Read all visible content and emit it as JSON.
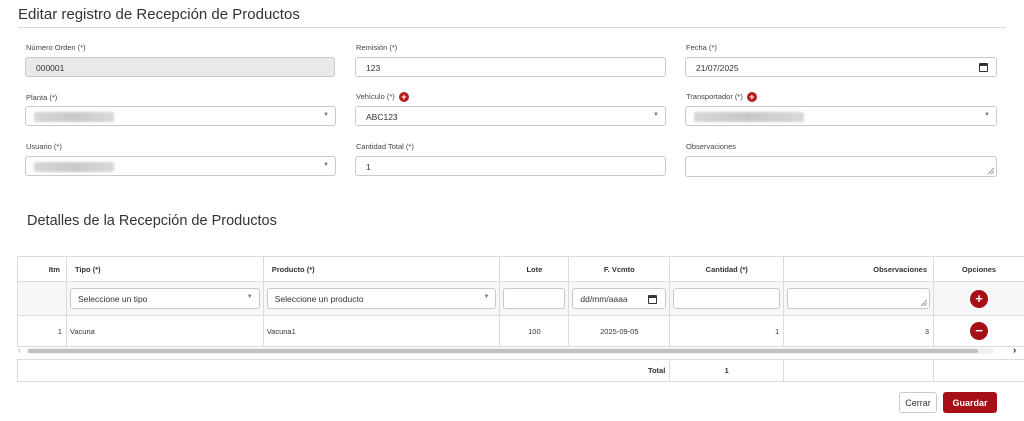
{
  "header": {
    "title": "Editar registro de Recepción de Productos"
  },
  "form": {
    "numero_orden": {
      "label": "Número Orden (*)",
      "value": "000001"
    },
    "remision": {
      "label": "Remisión (*)",
      "value": "123"
    },
    "fecha": {
      "label": "Fecha (*)",
      "value": "21/07/2025"
    },
    "planta": {
      "label": "Planta (*)",
      "value": ""
    },
    "vehiculo": {
      "label": "Vehículo (*)",
      "value": "ABC123"
    },
    "transportador": {
      "label": "Transportador (*)",
      "value": ""
    },
    "usuario": {
      "label": "Usuario (*)",
      "value": ""
    },
    "cantidad_total": {
      "label": "Cantidad Total (*)",
      "value": "1"
    },
    "observaciones": {
      "label": "Observaciones",
      "value": ""
    }
  },
  "details": {
    "title": "Detalles de la Recepción de Productos",
    "columns": {
      "itm": "Itm",
      "tipo": "Tipo (*)",
      "producto": "Producto (*)",
      "lote": "Lote",
      "vcmto": "F. Vcmto",
      "cantidad": "Cantidad (*)",
      "observaciones": "Observaciones",
      "opciones": "Opciones"
    },
    "new_row": {
      "tipo_placeholder": "Seleccione un tipo",
      "producto_placeholder": "Seleccione un producto",
      "fecha_placeholder": "dd/mm/aaaa"
    },
    "rows": [
      {
        "itm": "1",
        "tipo": "Vacuna",
        "producto": "Vacuna1",
        "lote": "100",
        "vcmto": "2025-09-05",
        "cantidad": "1",
        "observaciones": "3"
      }
    ],
    "footer": {
      "label": "Total",
      "value": "1"
    }
  },
  "actions": {
    "close_label": "Cerrar",
    "save_label": "Guardar"
  },
  "icons": {
    "add": "plus-circle-icon",
    "remove": "minus-circle-icon",
    "calendar": "calendar-icon",
    "dropdown": "chevron-down-icon"
  },
  "colors": {
    "accent": "#a50f15"
  }
}
